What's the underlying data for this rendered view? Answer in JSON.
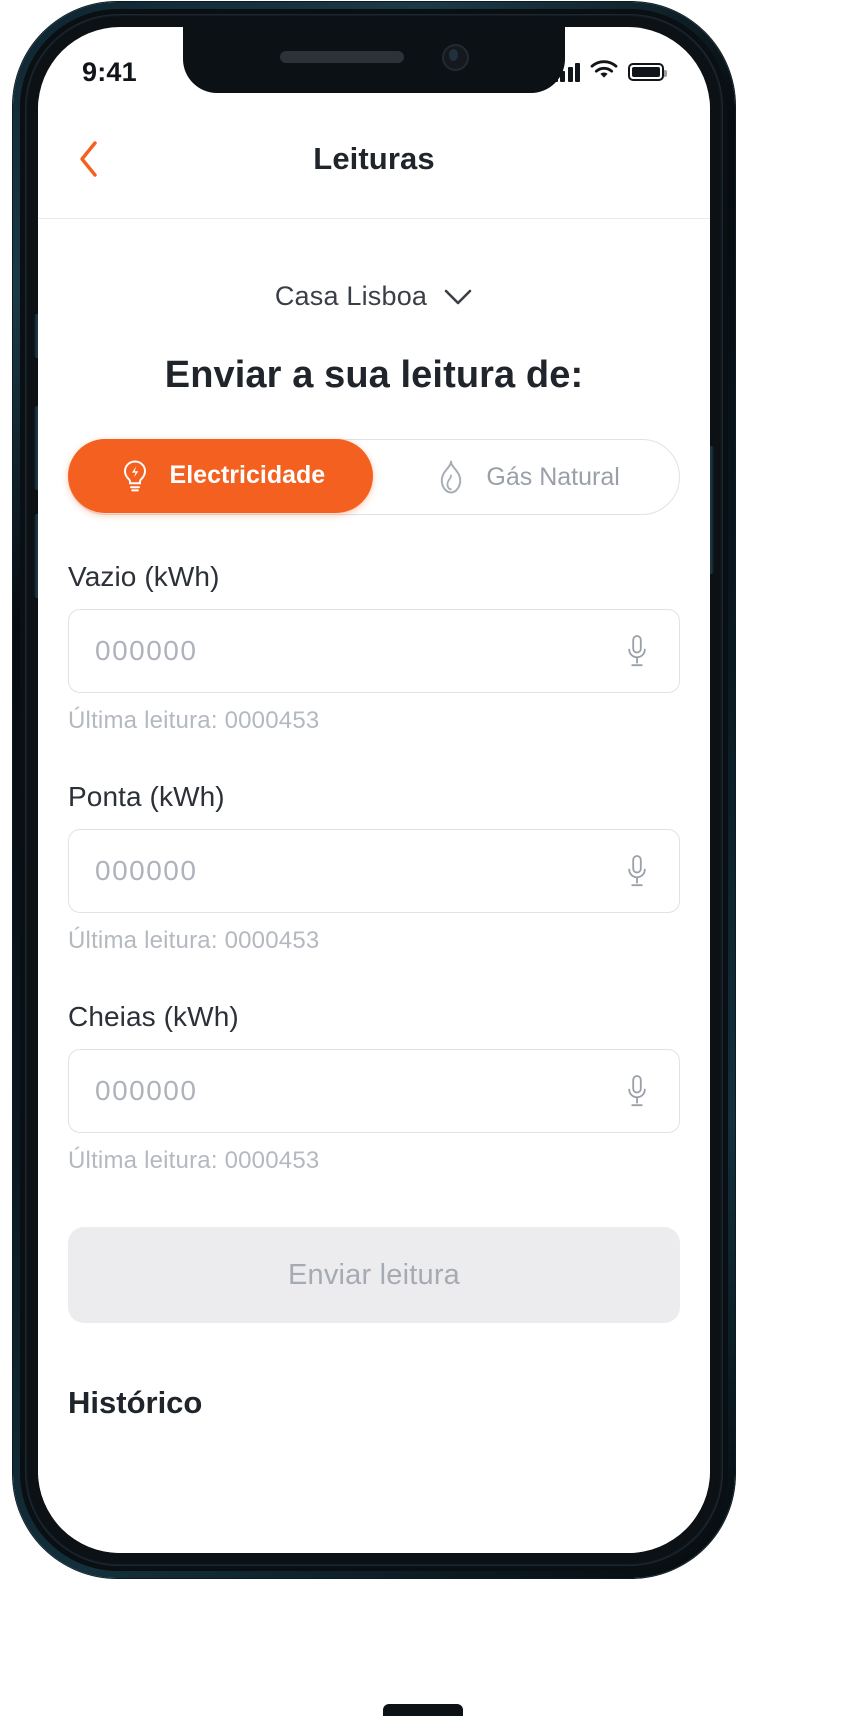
{
  "status_bar": {
    "time": "9:41",
    "signal_icon": "cellular-signal-icon",
    "wifi_icon": "wifi-icon",
    "battery_icon": "battery-icon"
  },
  "navbar": {
    "back_icon": "chevron-left-icon",
    "title": "Leituras"
  },
  "house_selector": {
    "name": "Casa Lisboa",
    "chevron_icon": "chevron-down-icon"
  },
  "heading": "Enviar a sua leitura de:",
  "segmented_control": {
    "options": [
      {
        "label": "Electricidade",
        "icon": "lightbulb-icon",
        "active": true
      },
      {
        "label": "Gás Natural",
        "icon": "flame-icon",
        "active": false
      }
    ]
  },
  "fields": [
    {
      "label": "Vazio (kWh)",
      "value": "",
      "placeholder": "000000",
      "hint": "Última leitura: 0000453",
      "mic_icon": "microphone-icon"
    },
    {
      "label": "Ponta (kWh)",
      "value": "",
      "placeholder": "000000",
      "hint": "Última leitura: 0000453",
      "mic_icon": "microphone-icon"
    },
    {
      "label": "Cheias (kWh)",
      "value": "",
      "placeholder": "000000",
      "hint": "Última leitura: 0000453",
      "mic_icon": "microphone-icon"
    }
  ],
  "submit_button": {
    "label": "Enviar leitura",
    "disabled": true
  },
  "history_section": {
    "title": "Histórico"
  },
  "colors": {
    "accent": "#f4601f",
    "text_primary": "#20242b",
    "text_muted": "#b4b9c0",
    "border": "#dfe2e6",
    "disabled_bg": "#ececee"
  }
}
